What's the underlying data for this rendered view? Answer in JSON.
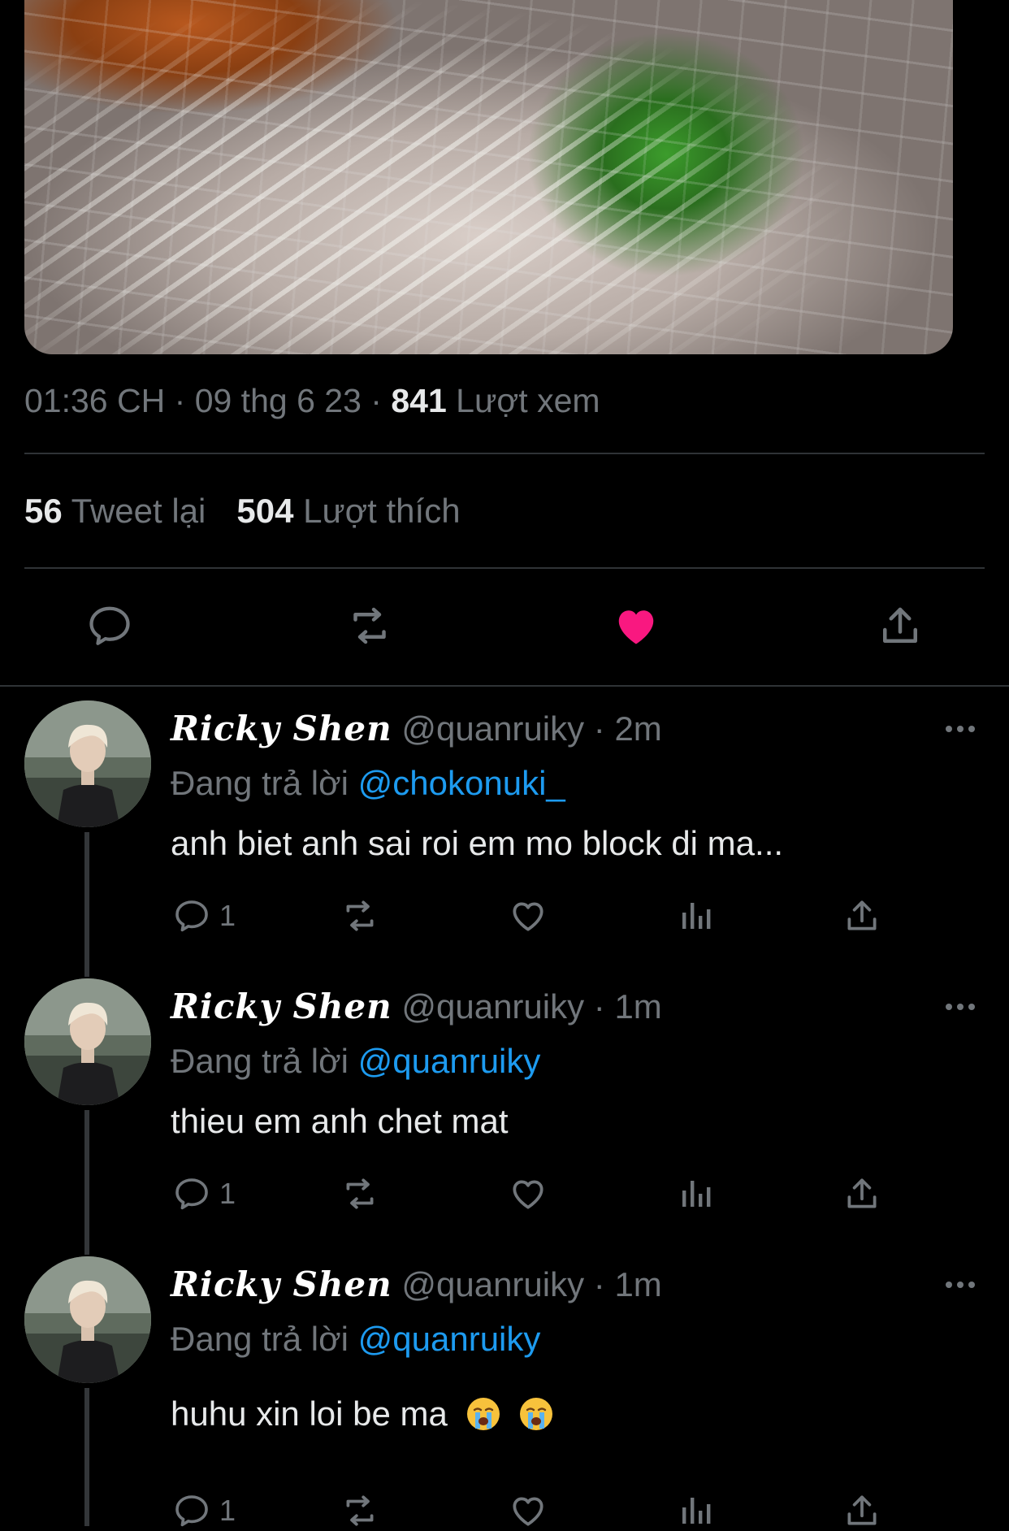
{
  "tweet": {
    "time": "01:36 CH",
    "sep1": "·",
    "date": "09 thg 6 23",
    "sep2": "·",
    "views_count": "841",
    "views_label": "Lượt xem",
    "retweets_count": "56",
    "retweets_label": "Tweet lại",
    "likes_count": "504",
    "likes_label": "Lượt thích",
    "liked": true
  },
  "colors": {
    "background": "#000000",
    "text": "#e7e9ea",
    "muted": "#71767b",
    "link": "#1d9bf0",
    "like": "#f91880",
    "divider": "#2f3336"
  },
  "action_bar": [
    "reply-icon",
    "retweet-icon",
    "like-icon-filled",
    "share-icon"
  ],
  "replies": [
    {
      "display_name": "Ricky Shen",
      "handle": "@quanruiky",
      "sep": "·",
      "time": "2m",
      "replying_label": "Đang trả lời",
      "replying_to": "@chokonuki_",
      "text": "anh biet anh sai roi em mo block di ma...",
      "emoji": [],
      "reply_count": "1"
    },
    {
      "display_name": "Ricky Shen",
      "handle": "@quanruiky",
      "sep": "·",
      "time": "1m",
      "replying_label": "Đang trả lời",
      "replying_to": "@quanruiky",
      "text": "thieu em anh chet mat",
      "emoji": [],
      "reply_count": "1"
    },
    {
      "display_name": "Ricky Shen",
      "handle": "@quanruiky",
      "sep": "·",
      "time": "1m",
      "replying_label": "Đang trả lời",
      "replying_to": "@quanruiky",
      "text": "huhu xin loi be ma",
      "emoji": [
        "loudly-crying-face",
        "loudly-crying-face"
      ],
      "reply_count": "1"
    }
  ]
}
